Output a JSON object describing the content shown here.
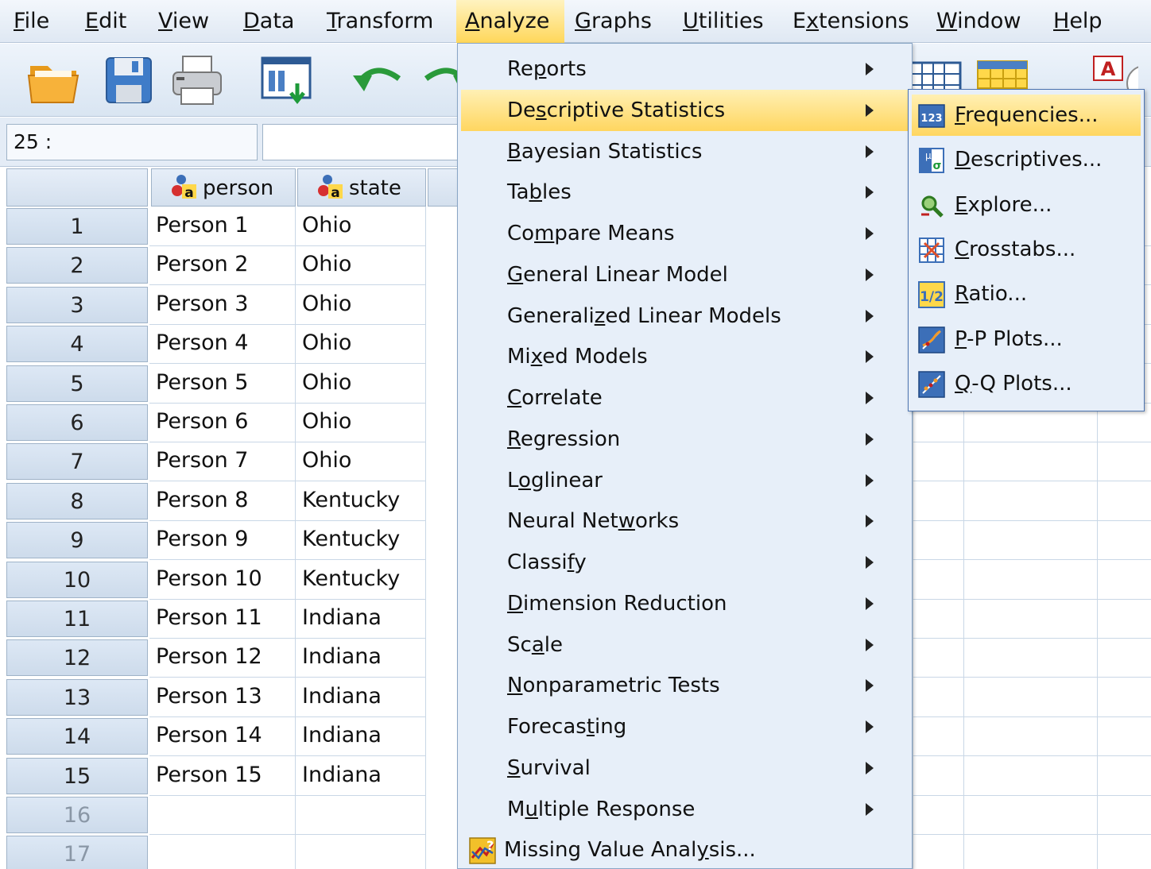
{
  "menubar": {
    "items": [
      {
        "pre": "",
        "ul": "F",
        "post": "ile"
      },
      {
        "pre": "",
        "ul": "E",
        "post": "dit"
      },
      {
        "pre": "",
        "ul": "V",
        "post": "iew"
      },
      {
        "pre": "",
        "ul": "D",
        "post": "ata"
      },
      {
        "pre": "",
        "ul": "T",
        "post": "ransform"
      },
      {
        "pre": "",
        "ul": "A",
        "post": "nalyze"
      },
      {
        "pre": "",
        "ul": "G",
        "post": "raphs"
      },
      {
        "pre": "",
        "ul": "U",
        "post": "tilities"
      },
      {
        "pre": "E",
        "ul": "x",
        "post": "tensions"
      },
      {
        "pre": "",
        "ul": "W",
        "post": "indow"
      },
      {
        "pre": "",
        "ul": "H",
        "post": "elp"
      }
    ]
  },
  "toolbar": {
    "icons": [
      "open-folder-icon",
      "save-icon",
      "print-icon",
      "dialog-recall-icon",
      "undo-icon",
      "redo-icon",
      "goto-case-icon",
      "goto-variable-icon",
      "value-labels-icon"
    ]
  },
  "cellbar": {
    "ref": "25 :",
    "value": ""
  },
  "grid": {
    "columns": [
      "person",
      "state"
    ],
    "rows": [
      {
        "n": "1",
        "person": "Person 1",
        "state": "Ohio"
      },
      {
        "n": "2",
        "person": "Person 2",
        "state": "Ohio"
      },
      {
        "n": "3",
        "person": "Person 3",
        "state": "Ohio"
      },
      {
        "n": "4",
        "person": "Person 4",
        "state": "Ohio"
      },
      {
        "n": "5",
        "person": "Person 5",
        "state": "Ohio"
      },
      {
        "n": "6",
        "person": "Person 6",
        "state": "Ohio"
      },
      {
        "n": "7",
        "person": "Person 7",
        "state": "Ohio"
      },
      {
        "n": "8",
        "person": "Person 8",
        "state": "Kentucky"
      },
      {
        "n": "9",
        "person": "Person 9",
        "state": "Kentucky"
      },
      {
        "n": "10",
        "person": "Person 10",
        "state": "Kentucky"
      },
      {
        "n": "11",
        "person": "Person 11",
        "state": "Indiana"
      },
      {
        "n": "12",
        "person": "Person 12",
        "state": "Indiana"
      },
      {
        "n": "13",
        "person": "Person 13",
        "state": "Indiana"
      },
      {
        "n": "14",
        "person": "Person 14",
        "state": "Indiana"
      },
      {
        "n": "15",
        "person": "Person 15",
        "state": "Indiana"
      },
      {
        "n": "16",
        "person": "",
        "state": ""
      },
      {
        "n": "17",
        "person": "",
        "state": ""
      }
    ]
  },
  "analyze_menu": {
    "items": [
      {
        "pre": "Re",
        "ul": "p",
        "post": "orts",
        "submenu": true
      },
      {
        "pre": "De",
        "ul": "s",
        "post": "criptive Statistics",
        "submenu": true,
        "highlighted": true
      },
      {
        "pre": "",
        "ul": "B",
        "post": "ayesian Statistics",
        "submenu": true
      },
      {
        "pre": "Ta",
        "ul": "b",
        "post": "les",
        "submenu": true
      },
      {
        "pre": "Co",
        "ul": "m",
        "post": "pare Means",
        "submenu": true
      },
      {
        "pre": "",
        "ul": "G",
        "post": "eneral Linear Model",
        "submenu": true
      },
      {
        "pre": "Generali",
        "ul": "z",
        "post": "ed Linear Models",
        "submenu": true
      },
      {
        "pre": "Mi",
        "ul": "x",
        "post": "ed Models",
        "submenu": true
      },
      {
        "pre": "",
        "ul": "C",
        "post": "orrelate",
        "submenu": true
      },
      {
        "pre": "",
        "ul": "R",
        "post": "egression",
        "submenu": true
      },
      {
        "pre": "L",
        "ul": "o",
        "post": "glinear",
        "submenu": true
      },
      {
        "pre": "Neural Net",
        "ul": "w",
        "post": "orks",
        "submenu": true
      },
      {
        "pre": "Classi",
        "ul": "f",
        "post": "y",
        "submenu": true
      },
      {
        "pre": "",
        "ul": "D",
        "post": "imension Reduction",
        "submenu": true
      },
      {
        "pre": "Sc",
        "ul": "a",
        "post": "le",
        "submenu": true
      },
      {
        "pre": "",
        "ul": "N",
        "post": "onparametric Tests",
        "submenu": true
      },
      {
        "pre": "Forecas",
        "ul": "t",
        "post": "ing",
        "submenu": true
      },
      {
        "pre": "",
        "ul": "S",
        "post": "urvival",
        "submenu": true
      },
      {
        "pre": "M",
        "ul": "u",
        "post": "ltiple Response",
        "submenu": true
      },
      {
        "pre": "Missing Value Anal",
        "ul": "y",
        "post": "sis...",
        "submenu": false,
        "icon": "missing-value-icon"
      }
    ]
  },
  "descriptive_menu": {
    "items": [
      {
        "pre": "",
        "ul": "F",
        "post": "requencies...",
        "icon": "frequencies-icon",
        "highlighted": true
      },
      {
        "pre": "",
        "ul": "D",
        "post": "escriptives...",
        "icon": "descriptives-icon"
      },
      {
        "pre": "",
        "ul": "E",
        "post": "xplore...",
        "icon": "explore-icon"
      },
      {
        "pre": "",
        "ul": "C",
        "post": "rosstabs...",
        "icon": "crosstabs-icon"
      },
      {
        "pre": "",
        "ul": "R",
        "post": "atio...",
        "icon": "ratio-icon"
      },
      {
        "pre": "",
        "ul": "P",
        "post": "-P Plots...",
        "icon": "pp-plots-icon"
      },
      {
        "pre": "",
        "ul": "Q",
        "post": "-Q Plots...",
        "icon": "qq-plots-icon"
      }
    ]
  }
}
